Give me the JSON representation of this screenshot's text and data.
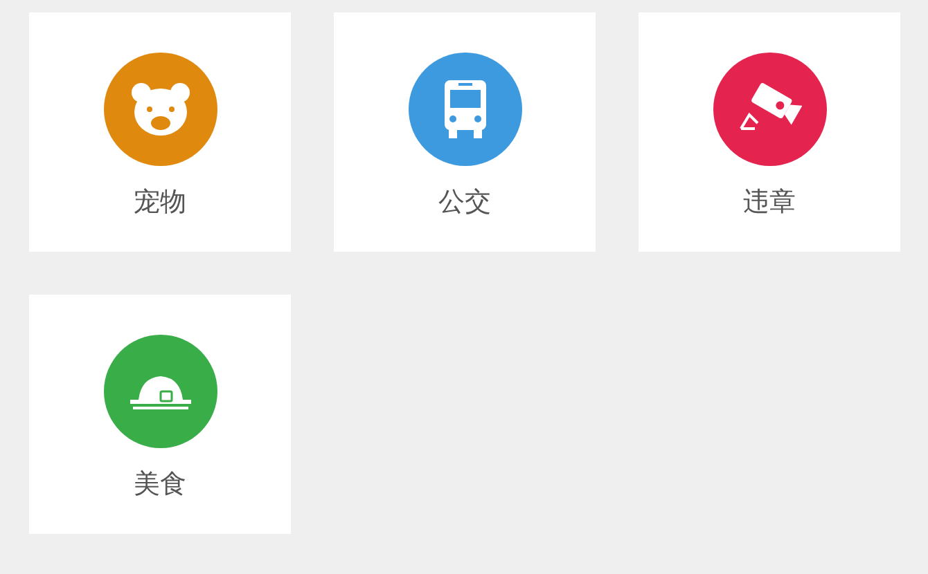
{
  "categories": [
    {
      "label": "宠物",
      "kind": "pet",
      "color": "#e0890f"
    },
    {
      "label": "公交",
      "kind": "bus",
      "color": "#3d9ade"
    },
    {
      "label": "违章",
      "kind": "camera",
      "color": "#e4234e"
    },
    {
      "label": "美食",
      "kind": "food",
      "color": "#39ad47"
    }
  ]
}
